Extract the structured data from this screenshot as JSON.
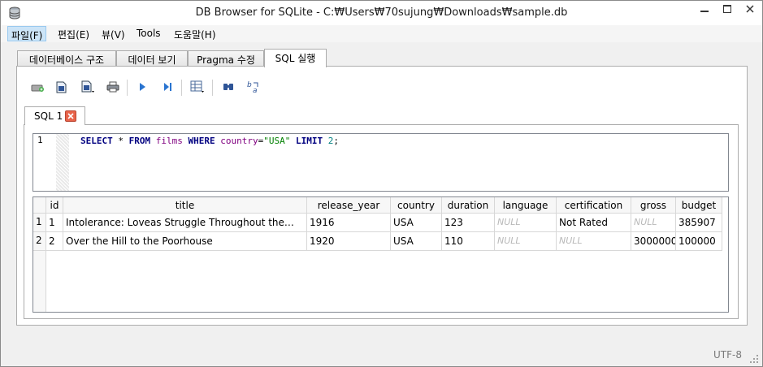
{
  "window": {
    "title": "DB Browser for SQLite - C:₩Users₩70sujung₩Downloads₩sample.db"
  },
  "menu": [
    {
      "label": "파일(F)"
    },
    {
      "label": "편집(E)"
    },
    {
      "label": "뷰(V)"
    },
    {
      "label": "Tools"
    },
    {
      "label": "도움말(H)"
    }
  ],
  "main_tabs": [
    {
      "label": "데이터베이스 구조"
    },
    {
      "label": "데이터 보기"
    },
    {
      "label": "Pragma 수정"
    },
    {
      "label": "SQL 실행"
    }
  ],
  "toolbar": {
    "icons": [
      "open-tab-icon",
      "open-sql-file-icon",
      "save-sql-file-icon",
      "print-icon",
      "execute-all-icon",
      "execute-line-icon",
      "save-results-icon",
      "find-icon",
      "find-replace-icon"
    ]
  },
  "sql_tabs": [
    {
      "label": "SQL 1"
    }
  ],
  "editor": {
    "line_number": "1",
    "tokens": {
      "kw_select": "SELECT",
      "star": " * ",
      "kw_from": "FROM",
      "table": "films",
      "kw_where": "WHERE",
      "column": "country",
      "eq": "=",
      "string": "\"USA\"",
      "kw_limit": "LIMIT",
      "limit_value": "2",
      "semicolon": ";"
    }
  },
  "results": {
    "columns": [
      "id",
      "title",
      "release_year",
      "country",
      "duration",
      "language",
      "certification",
      "gross",
      "budget"
    ],
    "rows": [
      {
        "row_no": "1",
        "cells": [
          "1",
          "Intolerance: Loveas Struggle Throughout the…",
          "1916",
          "USA",
          "123",
          "NULL",
          "Not Rated",
          "NULL",
          "385907"
        ]
      },
      {
        "row_no": "2",
        "cells": [
          "2",
          "Over the Hill to the Poorhouse",
          "1920",
          "USA",
          "110",
          "NULL",
          "NULL",
          "3000000",
          "100000"
        ]
      }
    ],
    "null_text": "NULL"
  },
  "statusbar": {
    "encoding": "UTF-8"
  }
}
